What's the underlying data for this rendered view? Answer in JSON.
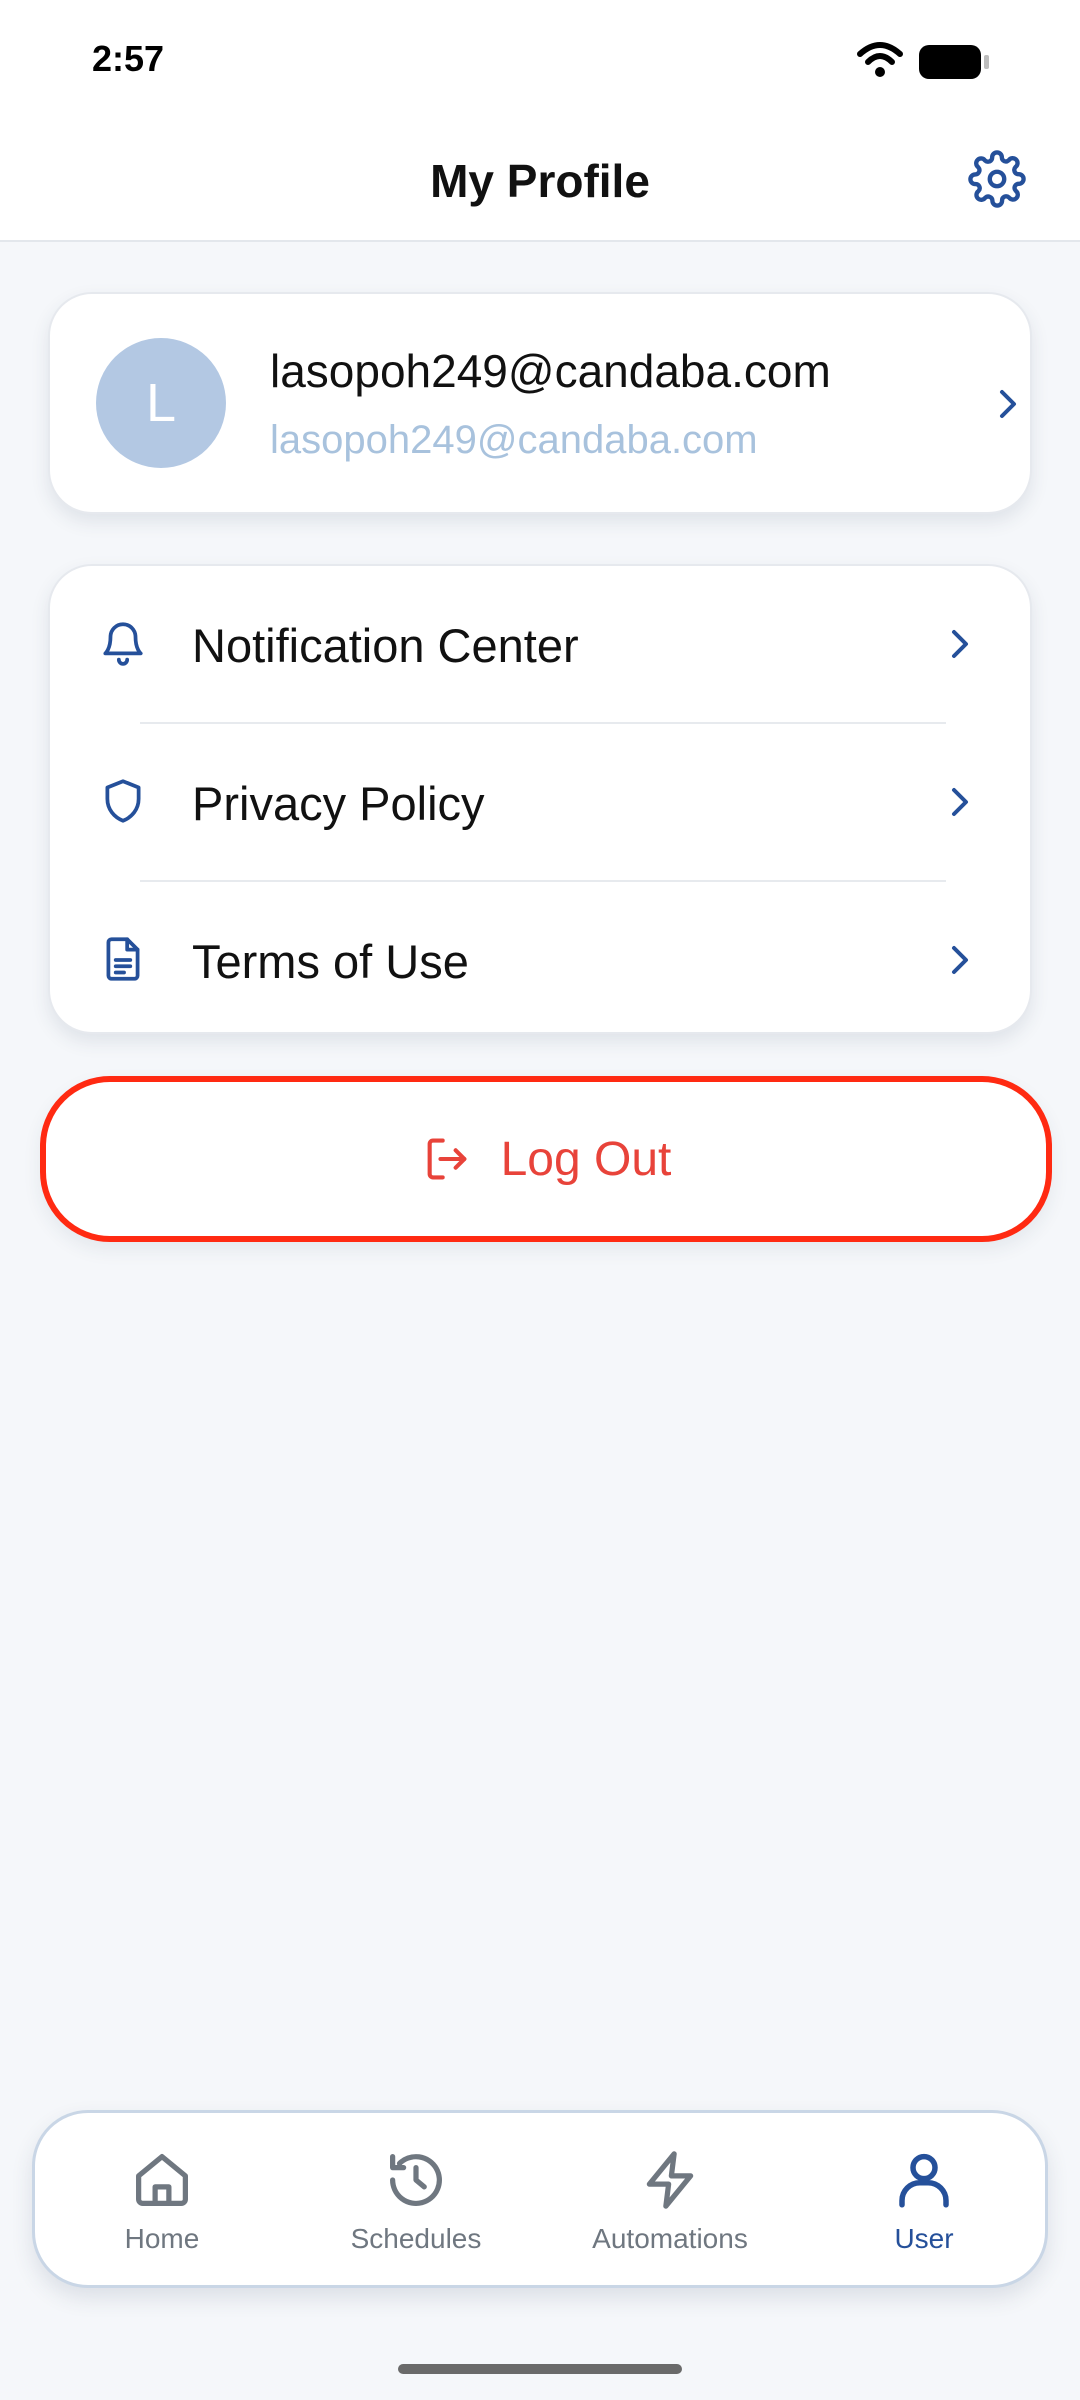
{
  "status_bar": {
    "time": "2:57"
  },
  "header": {
    "title": "My Profile",
    "settings_icon": "gear-icon"
  },
  "profile": {
    "avatar_initial": "L",
    "name": "lasopoh249@candaba.com",
    "email": "lasopoh249@candaba.com"
  },
  "menu": {
    "items": [
      {
        "label": "Notification Center",
        "icon": "bell-icon"
      },
      {
        "label": "Privacy Policy",
        "icon": "shield-icon"
      },
      {
        "label": "Terms of Use",
        "icon": "document-icon"
      }
    ]
  },
  "logout": {
    "label": "Log Out",
    "icon": "logout-icon"
  },
  "bottom_nav": {
    "items": [
      {
        "label": "Home",
        "icon": "home-icon",
        "active": false
      },
      {
        "label": "Schedules",
        "icon": "history-icon",
        "active": false
      },
      {
        "label": "Automations",
        "icon": "lightning-icon",
        "active": false
      },
      {
        "label": "User",
        "icon": "user-icon",
        "active": true
      }
    ]
  },
  "colors": {
    "accent": "#25509a",
    "danger": "#e8433a",
    "highlight_border": "#ff2a12",
    "avatar_bg": "#b3c8e3",
    "muted_email": "#a8c2dd"
  }
}
